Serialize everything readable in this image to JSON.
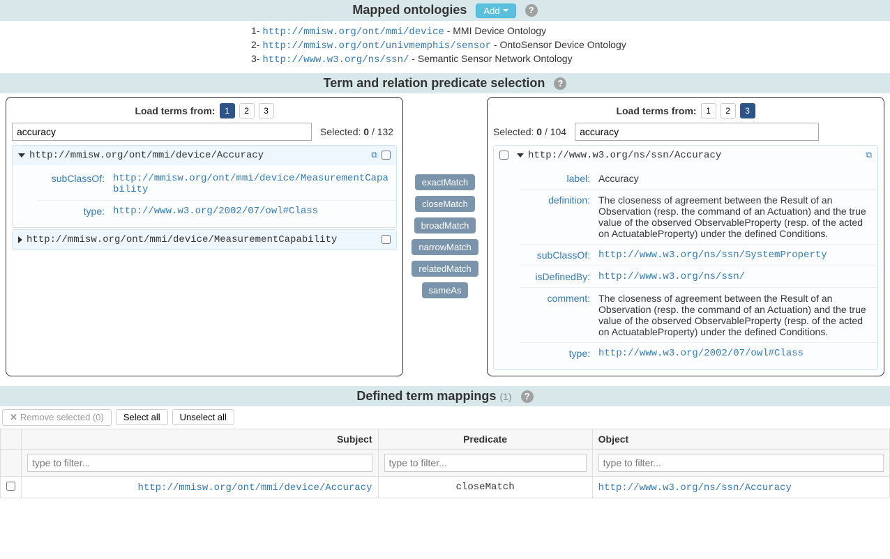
{
  "header": {
    "mapped_title": "Mapped ontologies",
    "add_label": "Add",
    "ontologies": [
      {
        "index": "1-",
        "url": "http://mmisw.org/ont/mmi/device",
        "desc": " - MMI Device Ontology"
      },
      {
        "index": "2-",
        "url": "http://mmisw.org/ont/univmemphis/sensor",
        "desc": " - OntoSensor Device Ontology"
      },
      {
        "index": "3-",
        "url": "http://www.w3.org/ns/ssn/",
        "desc": " - Semantic Sensor Network Ontology"
      }
    ],
    "selection_title": "Term and relation predicate selection"
  },
  "left": {
    "load_label": "Load terms from:",
    "tabs": [
      "1",
      "2",
      "3"
    ],
    "active_tab_index": 0,
    "search_value": "accuracy",
    "selected_prefix": "Selected: ",
    "selected_count": "0",
    "selected_total": " / 132",
    "term1_url": "http://mmisw.org/ont/mmi/device/Accuracy",
    "props": {
      "subclass_key": "subClassOf:",
      "subclass_val": "http://mmisw.org/ont/mmi/device/MeasurementCapability",
      "type_key": "type:",
      "type_val": "http://www.w3.org/2002/07/owl#Class"
    },
    "term2_url": "http://mmisw.org/ont/mmi/device/MeasurementCapability"
  },
  "predicates": {
    "exactMatch": "exactMatch",
    "closeMatch": "closeMatch",
    "broadMatch": "broadMatch",
    "narrowMatch": "narrowMatch",
    "relatedMatch": "relatedMatch",
    "sameAs": "sameAs"
  },
  "right": {
    "load_label": "Load terms from:",
    "tabs": [
      "1",
      "2",
      "3"
    ],
    "active_tab_index": 2,
    "search_value": "accuracy",
    "selected_prefix": "Selected: ",
    "selected_count": "0",
    "selected_total": " / 104",
    "term_url": "http://www.w3.org/ns/ssn/Accuracy",
    "props": {
      "label_key": "label:",
      "label_val": "Accuracy",
      "definition_key": "definition:",
      "definition_val": "The closeness of agreement between the Result of an Observation (resp. the command of an Actuation) and the true value of the observed ObservableProperty (resp. of the acted on ActuatableProperty) under the defined Conditions.",
      "subclass_key": "subClassOf:",
      "subclass_val": "http://www.w3.org/ns/ssn/SystemProperty",
      "isdef_key": "isDefinedBy:",
      "isdef_val": "http://www.w3.org/ns/ssn/",
      "comment_key": "comment:",
      "comment_val": "The closeness of agreement between the Result of an Observation (resp. the command of an Actuation) and the true value of the observed ObservableProperty (resp. of the acted on ActuatableProperty) under the defined Conditions.",
      "type_key": "type:",
      "type_val": "http://www.w3.org/2002/07/owl#Class"
    }
  },
  "mappings": {
    "title": "Defined term mappings",
    "count": "(1)",
    "remove_label": "Remove selected (0)",
    "select_all": "Select all",
    "unselect_all": "Unselect all",
    "columns": {
      "subject": "Subject",
      "predicate": "Predicate",
      "object": "Object"
    },
    "filter_placeholder": "type to filter...",
    "rows": [
      {
        "subject": "http://mmisw.org/ont/mmi/device/Accuracy",
        "predicate": "closeMatch",
        "object": "http://www.w3.org/ns/ssn/Accuracy"
      }
    ]
  }
}
